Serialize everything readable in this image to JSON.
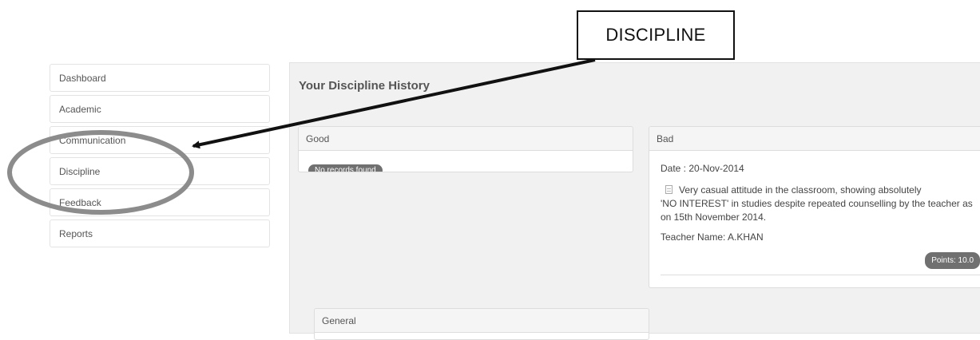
{
  "sidebar": {
    "items": [
      {
        "label": "Dashboard"
      },
      {
        "label": "Academic"
      },
      {
        "label": "Communication"
      },
      {
        "label": "Discipline"
      },
      {
        "label": "Feedback"
      },
      {
        "label": "Reports"
      }
    ]
  },
  "main": {
    "title": "Your Discipline History",
    "good": {
      "heading": "Good",
      "empty_badge": "No records found"
    },
    "bad": {
      "heading": "Bad",
      "date": "Date : 20-Nov-2014",
      "description_line1": "Very casual attitude in the classroom, showing absolutely",
      "description_rest": "'NO INTEREST' in studies despite repeated counselling by the teacher as on 15th November 2014.",
      "teacher": "Teacher Name: A.KHAN",
      "points_badge": "Points: 10.0"
    },
    "general": {
      "heading": "General"
    }
  },
  "annotation": {
    "callout_label": "DISCIPLINE",
    "color": "#111111",
    "circle_color": "#8c8c8c"
  }
}
